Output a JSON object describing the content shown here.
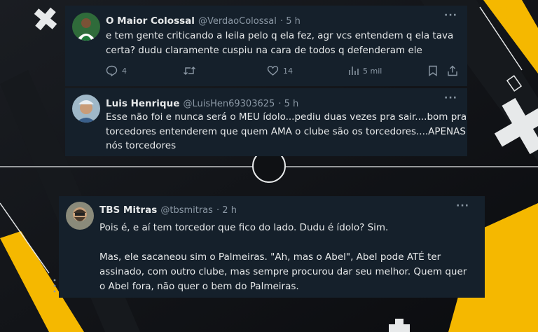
{
  "colors": {
    "card_bg": "#15202b",
    "text": "#e7e9ea",
    "muted": "#8b98a5",
    "accent_yellow": "#f5b800",
    "background": "#0f1114"
  },
  "tweets": [
    {
      "name": "O Maior Colossal",
      "handle": "@VerdaoColossal",
      "time": "· 5 h",
      "more": "···",
      "lines": [
        "e tem gente criticando a leila pelo q ela fez, agr vcs entendem q ela tava",
        "certa? dudu claramente cuspiu na cara de todos q defenderam ele"
      ],
      "replies": "4",
      "likes": "14",
      "views": "5 mil",
      "icons": [
        "reply-icon",
        "retweet-icon",
        "like-icon",
        "views-icon",
        "bookmark-icon",
        "share-icon"
      ]
    },
    {
      "name": "Luis Henrique",
      "handle": "@LuisHen69303625",
      "time": "· 5 h",
      "more": "···",
      "lines": [
        "Esse não foi e nunca será o MEU ídolo...pediu duas vezes pra sair....bom pra",
        "torcedores entenderem que quem AMA o clube são os torcedores....APENAS",
        "nós torcedores"
      ]
    },
    {
      "name": "TBS Mitras",
      "handle": "@tbsmitras",
      "time": "· 2 h",
      "more": "···",
      "lines": [
        "Pois é, e aí tem torcedor que fico do lado. Dudu é ídolo? Sim.",
        "",
        "Mas, ele sacaneou sim o Palmeiras. \"Ah, mas o Abel\", Abel pode ATÉ ter",
        "assinado, com outro clube, mas sempre procurou dar seu melhor. Quem quer",
        "o Abel fora, não quer o bem do Palmeiras."
      ]
    }
  ]
}
